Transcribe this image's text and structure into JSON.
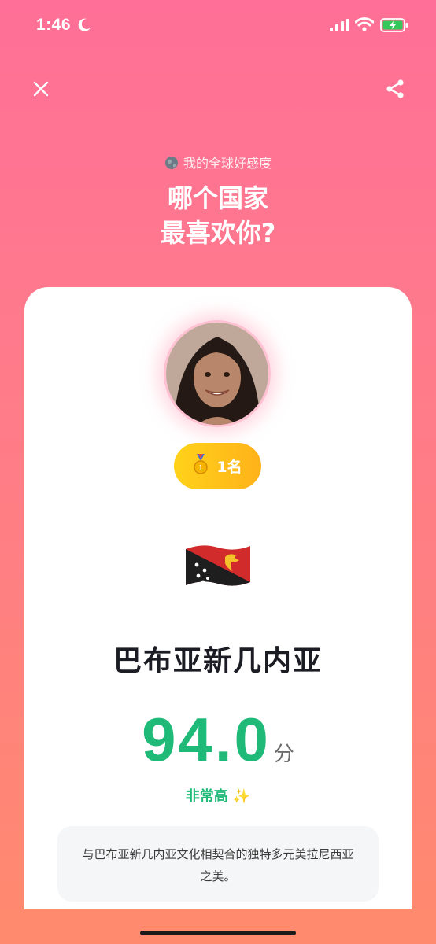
{
  "status_bar": {
    "time": "1:46"
  },
  "header": {
    "subtitle": "我的全球好感度",
    "title_line1": "哪个国家",
    "title_line2": "最喜欢你?"
  },
  "result": {
    "rank_label": "1名",
    "country": "巴布亚新几内亚",
    "score": "94.0",
    "score_unit": "分",
    "level": "非常高",
    "level_emoji": "✨",
    "description": "与巴布亚新几内亚文化相契合的独特多元美拉尼西亚之美。"
  },
  "colors": {
    "background_top": "#ff6f97",
    "background_bottom": "#ff8a6e",
    "score_green": "#1fb978",
    "badge_gold": "#ffc21a"
  },
  "icons": [
    "moon-icon",
    "signal-icon",
    "wifi-icon",
    "battery-charging-icon",
    "close-icon",
    "share-icon",
    "globe-icon",
    "medal-icon",
    "papua-new-guinea-flag"
  ]
}
